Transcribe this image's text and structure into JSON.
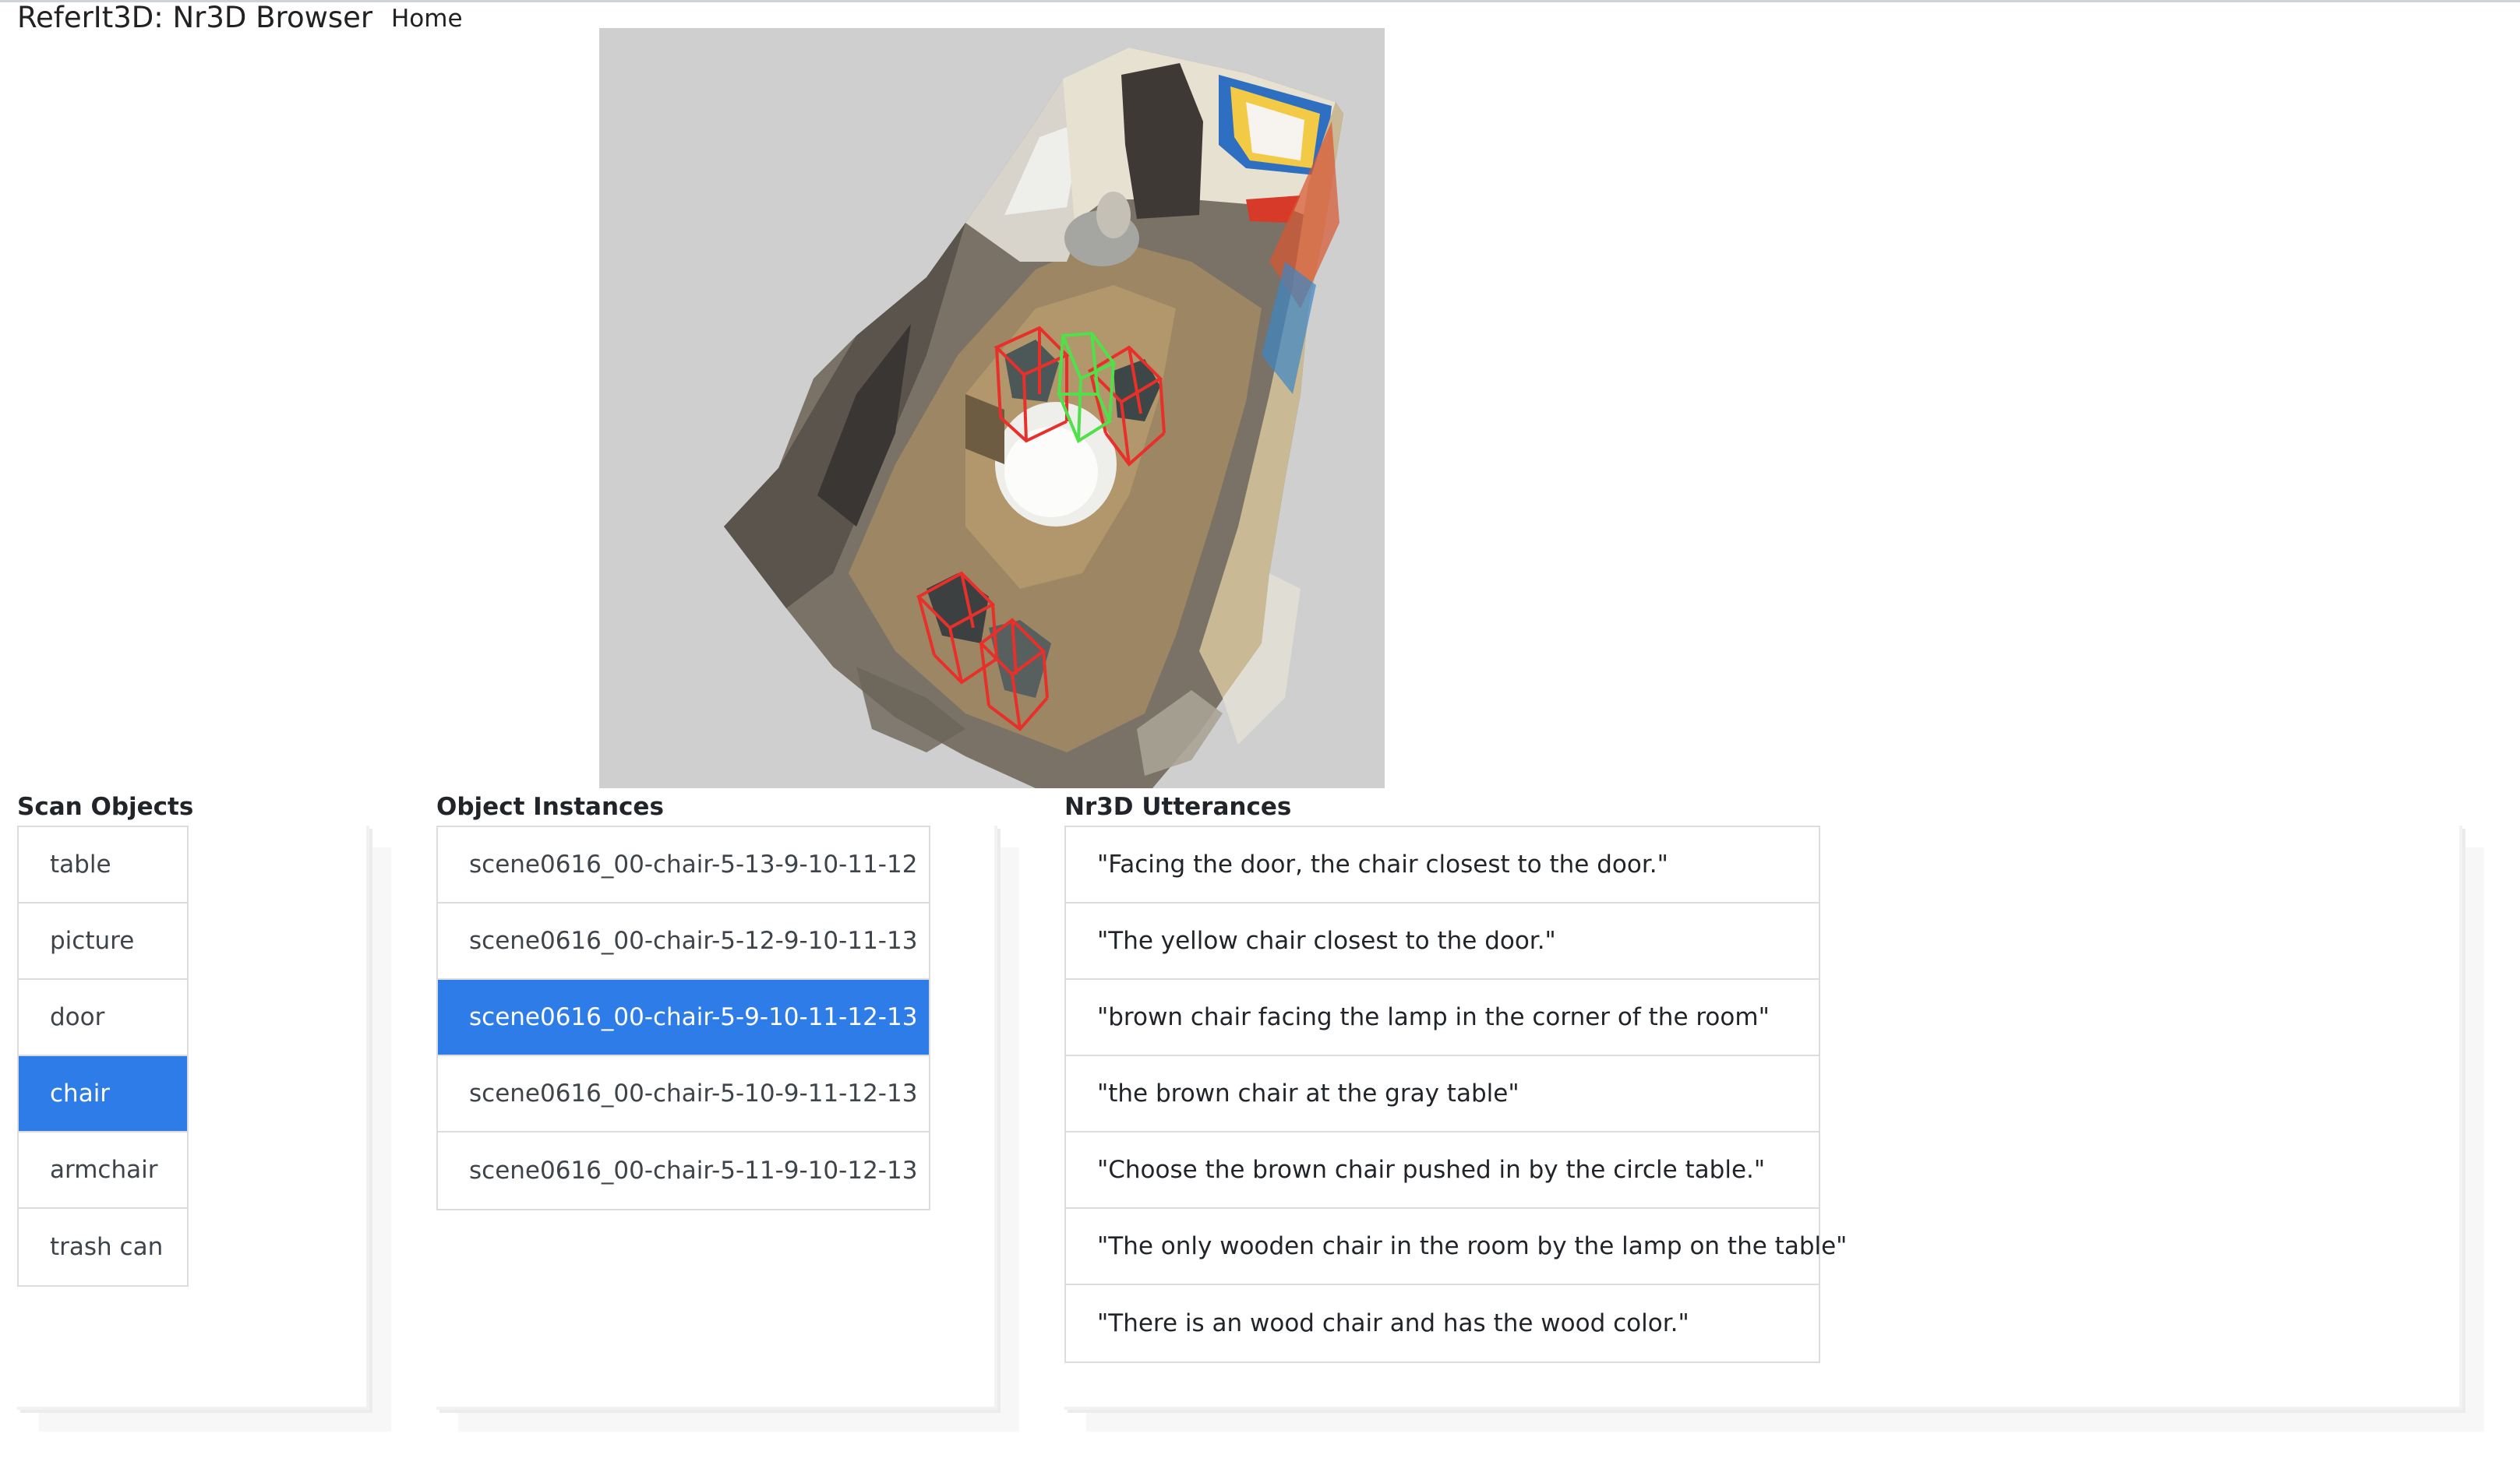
{
  "navbar": {
    "brand": "ReferIt3D: Nr3D Browser",
    "home_link": "Home"
  },
  "viewer": {
    "description": "3D point-cloud scan of room with bounding boxes",
    "target_box_color": "#4fe04a",
    "distractor_box_color": "#e8302a",
    "background_color": "#cfcfcf"
  },
  "scan_objects": {
    "title": "Scan Objects",
    "items": [
      "table",
      "picture",
      "door",
      "chair",
      "armchair",
      "trash can"
    ],
    "selected": "chair"
  },
  "object_instances": {
    "title": "Object Instances",
    "items": [
      "scene0616_00-chair-5-13-9-10-11-12",
      "scene0616_00-chair-5-12-9-10-11-13",
      "scene0616_00-chair-5-9-10-11-12-13",
      "scene0616_00-chair-5-10-9-11-12-13",
      "scene0616_00-chair-5-11-9-10-12-13"
    ],
    "selected": "scene0616_00-chair-5-9-10-11-12-13"
  },
  "utterances": {
    "title": "Nr3D Utterances",
    "items": [
      "\"Facing the door, the chair closest to the door.\"",
      "\"The yellow chair closest to the door.\"",
      "\"brown chair facing the lamp in the corner of the room\"",
      "\"the brown chair at the gray table\"",
      "\"Choose the brown chair pushed in by the circle table.\"",
      "\"The only wooden chair in the room by the lamp on the table\"",
      "\"There is an wood chair and has the wood color.\""
    ]
  },
  "colors": {
    "selected_bg": "#2d7ce8",
    "selected_text": "#ffffff"
  }
}
